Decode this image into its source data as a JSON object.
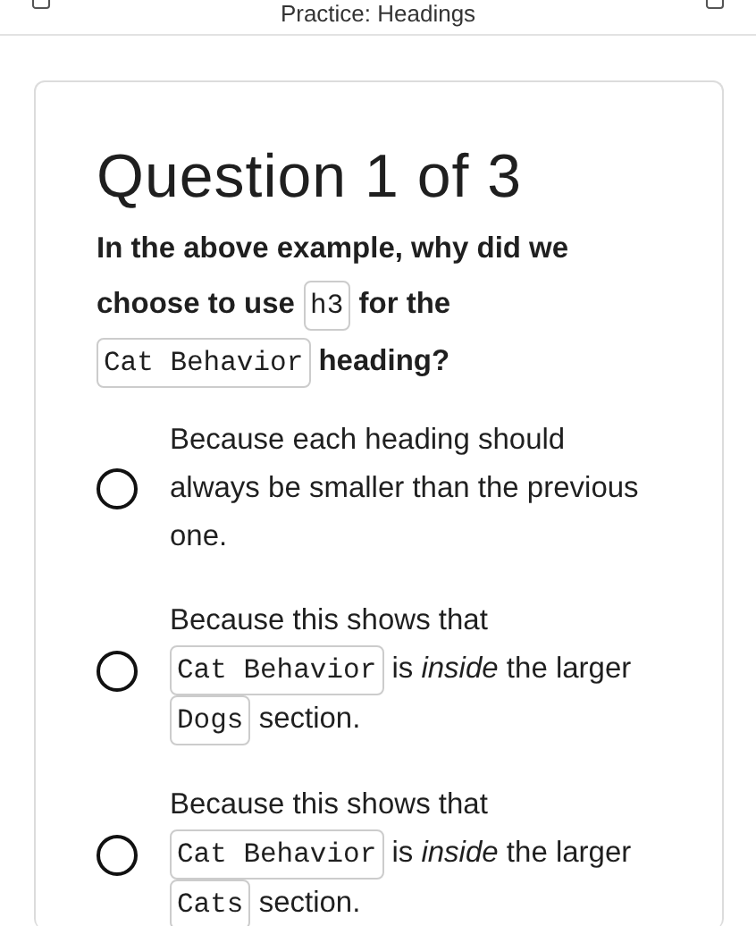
{
  "header": {
    "title": "Practice: Headings"
  },
  "question": {
    "heading": "Question 1 of 3",
    "parts": [
      {
        "kind": "text",
        "text": "In the above example, why did we"
      },
      {
        "kind": "text",
        "text": "choose to use"
      },
      {
        "kind": "code",
        "text": "h3"
      },
      {
        "kind": "text",
        "text": "for the"
      },
      {
        "kind": "code",
        "text": "Cat Behavior"
      },
      {
        "kind": "text",
        "text": "heading?"
      }
    ]
  },
  "options": [
    {
      "selected": false,
      "parts": [
        {
          "kind": "text",
          "text": "Because each heading should always be smaller than the previous one."
        }
      ]
    },
    {
      "selected": false,
      "parts": [
        {
          "kind": "text",
          "text": "Because this shows that"
        },
        {
          "kind": "code",
          "text": "Cat Behavior"
        },
        {
          "kind": "text",
          "text": "is *inside* the larger"
        },
        {
          "kind": "code",
          "text": "Dogs"
        },
        {
          "kind": "text",
          "text": "section."
        }
      ]
    },
    {
      "selected": false,
      "parts": [
        {
          "kind": "text",
          "text": "Because this shows that"
        },
        {
          "kind": "code",
          "text": "Cat Behavior"
        },
        {
          "kind": "text",
          "text": "is *inside* the larger"
        },
        {
          "kind": "code",
          "text": "Cats"
        },
        {
          "kind": "text",
          "text": "section."
        }
      ]
    }
  ]
}
